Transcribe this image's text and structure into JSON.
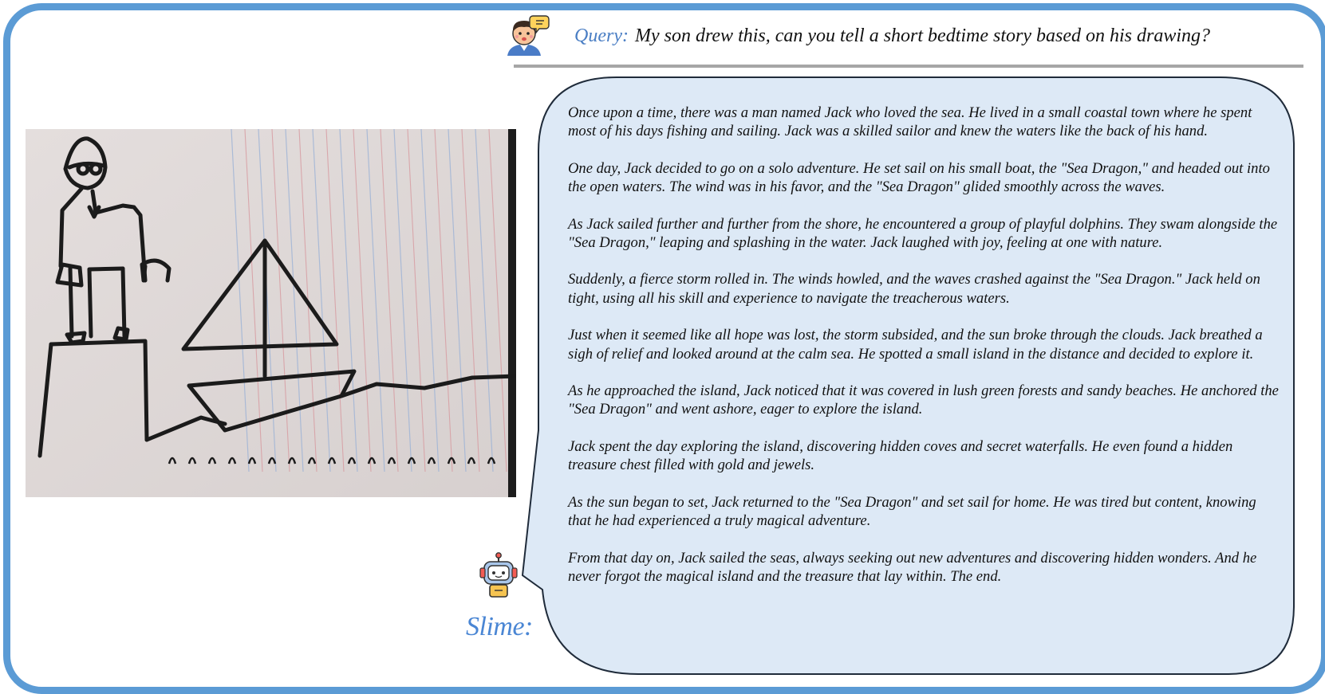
{
  "query": {
    "label": "Query:",
    "text": "My son drew this, can you tell a short bedtime story based on his drawing?"
  },
  "assistant": {
    "name": "Slime:"
  },
  "story": {
    "paragraphs": [
      "Once upon a time, there was a man named Jack who loved the sea. He lived in a small coastal town where he spent most of his days fishing and sailing. Jack was a skilled sailor and knew the waters like the back of his hand.",
      "One day, Jack decided to go on a solo adventure. He set sail on his small boat, the \"Sea Dragon,\" and headed out into the open waters. The wind was in his favor, and the \"Sea Dragon\" glided smoothly across the waves.",
      "As Jack sailed further and further from the shore, he encountered a group of playful dolphins. They swam alongside the \"Sea Dragon,\" leaping and splashing in the water. Jack laughed with joy, feeling at one with nature.",
      "Suddenly, a fierce storm rolled in. The winds howled, and the waves crashed against the \"Sea Dragon.\" Jack held on tight, using all his skill and experience to navigate the treacherous waters.",
      "Just when it seemed like all hope was lost, the storm subsided, and the sun broke through the clouds. Jack breathed a sigh of relief and looked around at the calm sea. He spotted a small island in the distance and decided to explore it.",
      "As he approached the island, Jack noticed that it was covered in lush green forests and sandy beaches. He anchored the \"Sea Dragon\" and went ashore, eager to explore the island.",
      "Jack spent the day exploring the island, discovering hidden coves and secret waterfalls. He even found a hidden treasure chest filled with gold and jewels.",
      "As the sun began to set, Jack returned to the \"Sea Dragon\" and set sail for home. He was tired but content, knowing that he had experienced a truly magical adventure.",
      "From that day on, Jack sailed the seas, always seeking out new adventures and discovering hidden wonders. And he never forgot the magical island and the treasure that lay within. The end."
    ]
  },
  "icons": {
    "user": "boy-speaking-avatar-icon",
    "assistant": "robot-avatar-icon"
  },
  "colors": {
    "frame_border": "#5b9bd5",
    "bubble_fill": "#dde9f6",
    "query_label": "#4a7ec4",
    "assistant_name": "#4a86d4",
    "divider": "#a6a6a6"
  }
}
